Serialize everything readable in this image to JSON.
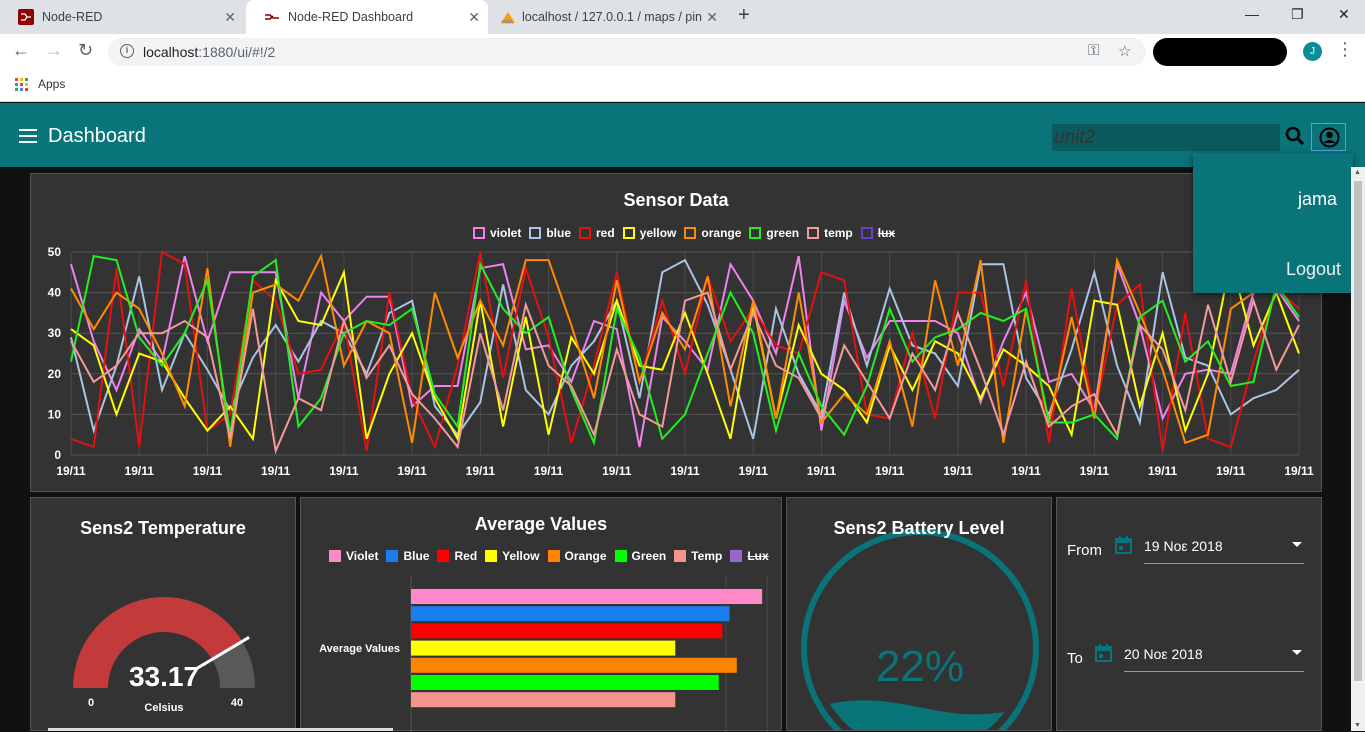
{
  "browser": {
    "tabs": [
      {
        "label": "Node-RED",
        "active": false
      },
      {
        "label": "Node-RED Dashboard",
        "active": true
      },
      {
        "label": "localhost / 127.0.0.1 / maps / pin",
        "active": false
      }
    ],
    "url_host": "localhost",
    "url_rest": ":1880/ui/#!/2",
    "profile_initial": "J",
    "bookmarks_apps": "Apps"
  },
  "toolbar": {
    "title": "Dashboard",
    "search_value": "unit2",
    "accent": "#097479"
  },
  "user_menu": {
    "name": "jama",
    "logout": "Logout"
  },
  "sensor_chart": {
    "title": "Sensor Data",
    "legend": [
      {
        "name": "violet",
        "color": "#ee82ee",
        "hidden": false
      },
      {
        "name": "blue",
        "color": "#a9c4e4",
        "hidden": false
      },
      {
        "name": "red",
        "color": "#e61010",
        "hidden": false
      },
      {
        "name": "yellow",
        "color": "#ffff00",
        "hidden": false
      },
      {
        "name": "orange",
        "color": "#ff8c00",
        "hidden": false
      },
      {
        "name": "green",
        "color": "#22ee22",
        "hidden": false
      },
      {
        "name": "temp",
        "color": "#f49a9a",
        "hidden": false
      },
      {
        "name": "lux",
        "color": "#6a3cd0",
        "hidden": true
      }
    ],
    "y_ticks": [
      "50",
      "40",
      "30",
      "20",
      "10",
      "0"
    ],
    "x_ticks": [
      "19/11",
      "19/11",
      "19/11",
      "19/11",
      "19/11",
      "19/11",
      "19/11",
      "19/11",
      "19/11",
      "19/11",
      "19/11",
      "19/11",
      "19/11",
      "19/11",
      "19/11",
      "19/11",
      "19/11",
      "19/11",
      "19/11"
    ]
  },
  "temperature_gauge": {
    "title": "Sens2 Temperature",
    "value": "33.17",
    "unit": "Celsius",
    "min": "0",
    "max": "40",
    "fraction": 0.829
  },
  "average_chart": {
    "title": "Average Values",
    "category_label": "Average Values",
    "legend": [
      {
        "name": "Violet",
        "color": "#ff88c8",
        "hidden": false
      },
      {
        "name": "Blue",
        "color": "#1a7ef0",
        "hidden": false
      },
      {
        "name": "Red",
        "color": "#ff0000",
        "hidden": false
      },
      {
        "name": "Yellow",
        "color": "#ffff00",
        "hidden": false
      },
      {
        "name": "Orange",
        "color": "#ff8400",
        "hidden": false
      },
      {
        "name": "Green",
        "color": "#00ff00",
        "hidden": false
      },
      {
        "name": "Temp",
        "color": "#f4948c",
        "hidden": false
      },
      {
        "name": "Lux",
        "color": "#9966cc",
        "hidden": true
      }
    ]
  },
  "battery": {
    "title": "Sens2 Battery Level",
    "value": "22%",
    "level": 0.22,
    "color": "#097479"
  },
  "date_range": {
    "from_label": "From",
    "from_value": "19 Νοε 2018",
    "to_label": "To",
    "to_value": "20 Νοε 2018"
  },
  "chart_data": [
    {
      "type": "line",
      "title": "Sensor Data",
      "ylim": [
        0,
        50
      ],
      "series": [
        {
          "name": "violet",
          "values": [
            47,
            28,
            16,
            31,
            23,
            49,
            28,
            45,
            45,
            45,
            14,
            40,
            33,
            39,
            39,
            12,
            17,
            17,
            46,
            47,
            26,
            27,
            18,
            33,
            31,
            2,
            34,
            28,
            21,
            47,
            38,
            25,
            49,
            6,
            38,
            24,
            33,
            33,
            33,
            30,
            13,
            28,
            40,
            18,
            20,
            11,
            47,
            32,
            9,
            20,
            21,
            20,
            40,
            41,
            33
          ]
        },
        {
          "name": "blue",
          "values": [
            29,
            6,
            22,
            44,
            16,
            30,
            21,
            11,
            24,
            32,
            23,
            33,
            30,
            20,
            35,
            38,
            12,
            5,
            13,
            42,
            16,
            10,
            22,
            28,
            38,
            14,
            45,
            48,
            37,
            21,
            4,
            36,
            20,
            10,
            40,
            22,
            41,
            27,
            25,
            17,
            47,
            47,
            19,
            10,
            26,
            45,
            22,
            8,
            45,
            24,
            22,
            10,
            14,
            16,
            21
          ]
        },
        {
          "name": "red",
          "values": [
            4,
            2,
            46,
            2,
            50,
            47,
            6,
            10,
            43,
            38,
            20,
            21,
            33,
            1,
            40,
            14,
            2,
            22,
            50,
            19,
            46,
            29,
            3,
            22,
            45,
            18,
            38,
            20,
            44,
            28,
            36,
            27,
            25,
            45,
            43,
            10,
            9,
            30,
            9,
            40,
            40,
            17,
            43,
            3,
            41,
            10,
            37,
            42,
            1,
            35,
            4,
            2,
            23,
            41,
            36
          ]
        },
        {
          "name": "yellow",
          "values": [
            31,
            27,
            10,
            25,
            23,
            14,
            6,
            12,
            4,
            43,
            33,
            32,
            45,
            4,
            20,
            30,
            14,
            4,
            38,
            7,
            34,
            5,
            29,
            20,
            38,
            22,
            21,
            35,
            20,
            4,
            37,
            9,
            32,
            20,
            16,
            8,
            27,
            16,
            28,
            25,
            14,
            26,
            22,
            17,
            5,
            38,
            37,
            12,
            30,
            6,
            20,
            48,
            27,
            40,
            25
          ]
        },
        {
          "name": "orange",
          "values": [
            41,
            31,
            40,
            36,
            25,
            12,
            46,
            2,
            40,
            42,
            38,
            49,
            22,
            33,
            30,
            3,
            40,
            24,
            38,
            27,
            48,
            48,
            32,
            14,
            43,
            18,
            35,
            26,
            44,
            12,
            38,
            9,
            40,
            8,
            15,
            10,
            28,
            7,
            43,
            22,
            48,
            3,
            36,
            8,
            34,
            9,
            48,
            35,
            21,
            3,
            5,
            36,
            40,
            41,
            44
          ]
        },
        {
          "name": "green",
          "values": [
            23,
            49,
            48,
            29,
            22,
            30,
            43,
            5,
            44,
            48,
            7,
            14,
            30,
            33,
            32,
            36,
            15,
            7,
            47,
            36,
            30,
            34,
            16,
            3,
            36,
            24,
            4,
            10,
            25,
            40,
            30,
            6,
            25,
            12,
            5,
            17,
            36,
            23,
            29,
            31,
            35,
            33,
            36,
            8,
            8,
            10,
            4,
            34,
            38,
            23,
            28,
            17,
            18,
            42,
            34
          ]
        },
        {
          "name": "temp",
          "values": [
            28,
            18,
            22,
            30,
            30,
            33,
            29,
            4,
            36,
            1,
            14,
            11,
            33,
            19,
            27,
            15,
            9,
            2,
            30,
            11,
            37,
            22,
            17,
            5,
            26,
            10,
            7,
            38,
            40,
            21,
            35,
            22,
            19,
            9,
            27,
            18,
            9,
            25,
            16,
            35,
            21,
            5,
            23,
            7,
            12,
            15,
            5,
            32,
            26,
            11,
            37,
            18,
            38,
            21,
            32
          ]
        }
      ]
    },
    {
      "type": "bar",
      "title": "Average Values",
      "categories": [
        "Average Values"
      ],
      "series": [
        {
          "name": "Violet",
          "values": [
            0.97
          ]
        },
        {
          "name": "Blue",
          "values": [
            0.88
          ]
        },
        {
          "name": "Red",
          "values": [
            0.86
          ]
        },
        {
          "name": "Yellow",
          "values": [
            0.73
          ]
        },
        {
          "name": "Orange",
          "values": [
            0.9
          ]
        },
        {
          "name": "Green",
          "values": [
            0.85
          ]
        },
        {
          "name": "Temp",
          "values": [
            0.73
          ]
        }
      ]
    }
  ]
}
